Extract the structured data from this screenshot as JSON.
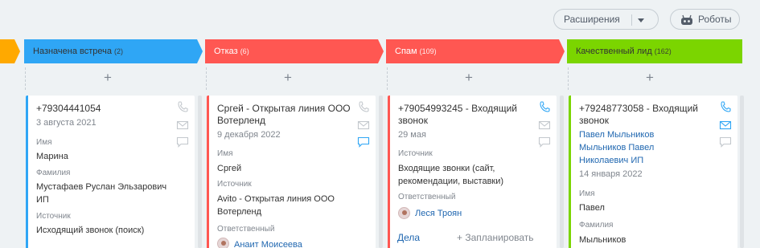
{
  "toolbar": {
    "extensions_label": "Расширения",
    "robots_label": "Роботы"
  },
  "stages": [
    {
      "name": "Назначена встреча",
      "count": "(2)",
      "color": "#2fa6f5"
    },
    {
      "name": "Отказ",
      "count": "(6)",
      "color": "#ff5752"
    },
    {
      "name": "Спам",
      "count": "(109)",
      "color": "#ff5752"
    },
    {
      "name": "Качественный лид",
      "count": "(162)",
      "color": "#7bd500"
    }
  ],
  "cards": [
    {
      "title": "+79304441054",
      "date": "3 августа 2021",
      "f1_label": "Имя",
      "f1_value": "Марина",
      "f2_label": "Фамилия",
      "f2_value": "Мустафаев Руслан Эльзарович ИП",
      "f3_label": "Источник",
      "f3_value": "Исходящий звонок (поиск)"
    },
    {
      "title": "Сргей - Открытая линия ООО Вотерленд",
      "date": "9 декабря 2022",
      "f1_label": "Имя",
      "f1_value": "Сргей",
      "f2_label": "Источник",
      "f2_value": "Avito - Открытая линия ООО Вотерленд",
      "f3_label": "Ответственный",
      "f3_value": "Анаит Моисеева"
    },
    {
      "title": "+79054993245 - Входящий звонок",
      "date": "29 мая",
      "f1_label": "Источник",
      "f1_value": "Входящие звонки (сайт, рекомендации, выставки)",
      "f2_label": "Ответственный",
      "f2_value": "Леся Троян",
      "deals": "Дела",
      "plan": "+ Запланировать"
    },
    {
      "title": "+79248773058 - Входящий звонок",
      "company": "Павел Мыльников Мыльников Павел Николаевич ИП",
      "date": "14 января 2022",
      "f1_label": "Имя",
      "f1_value": "Павел",
      "f2_label": "Фамилия",
      "f2_value": "Мыльников"
    }
  ]
}
